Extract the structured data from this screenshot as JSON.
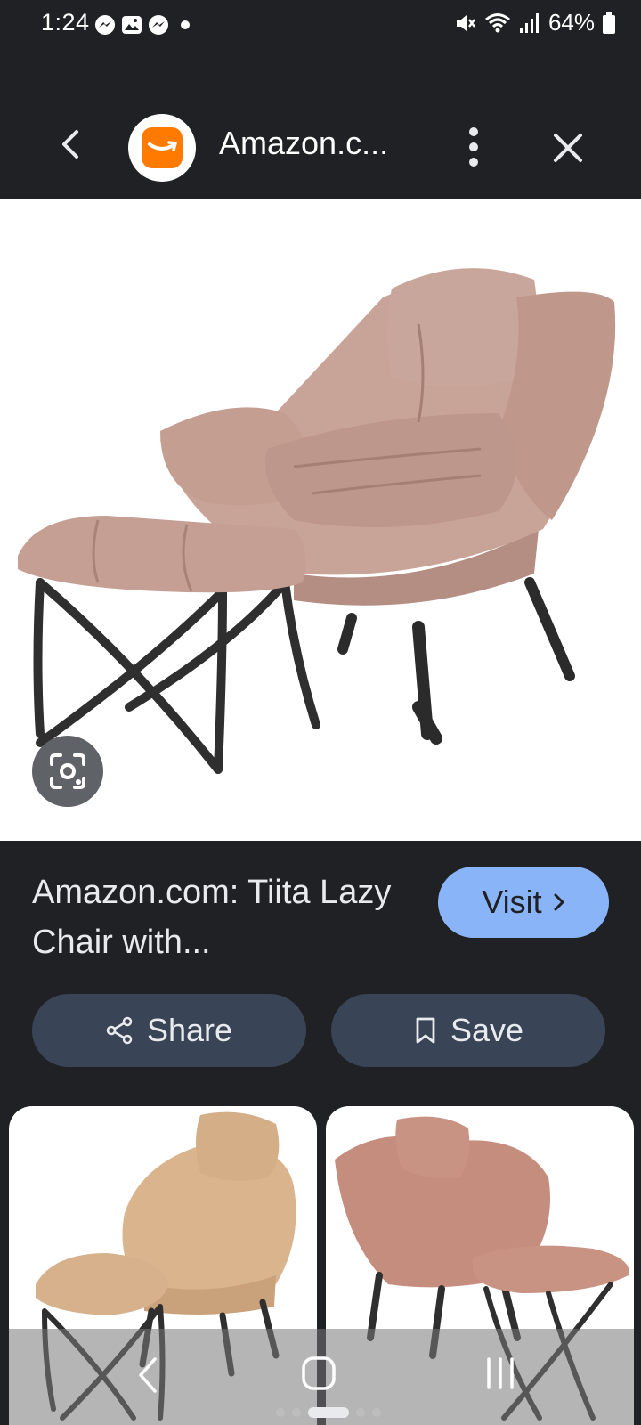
{
  "status_bar": {
    "time": "1:24",
    "battery_percent": "64%",
    "left_icons": [
      "messenger-icon",
      "gallery-icon",
      "messenger-icon",
      "dot-icon"
    ],
    "right_icons": [
      "mute-icon",
      "wifi-icon",
      "signal-icon",
      "battery-icon"
    ]
  },
  "top_bar": {
    "site_title": "Amazon.c...",
    "brand_color": "#ff7a00"
  },
  "hero": {
    "image_subject": "taupe lazy chair with ottoman",
    "lens_button_icon": "google-lens-icon"
  },
  "result": {
    "title": "Amazon.com: Tiita Lazy Chair with...",
    "visit_label": "Visit",
    "visit_color": "#8ab4f8"
  },
  "actions": {
    "share_label": "Share",
    "save_label": "Save"
  },
  "related": {
    "thumbnails": [
      "beige lazy chair with ottoman",
      "pink fluffy lazy chair with ottoman"
    ]
  },
  "nav_bar": {
    "buttons": [
      "back-icon",
      "home-icon",
      "recents-icon"
    ],
    "page_indicator": {
      "count": 5,
      "active": 2
    }
  }
}
